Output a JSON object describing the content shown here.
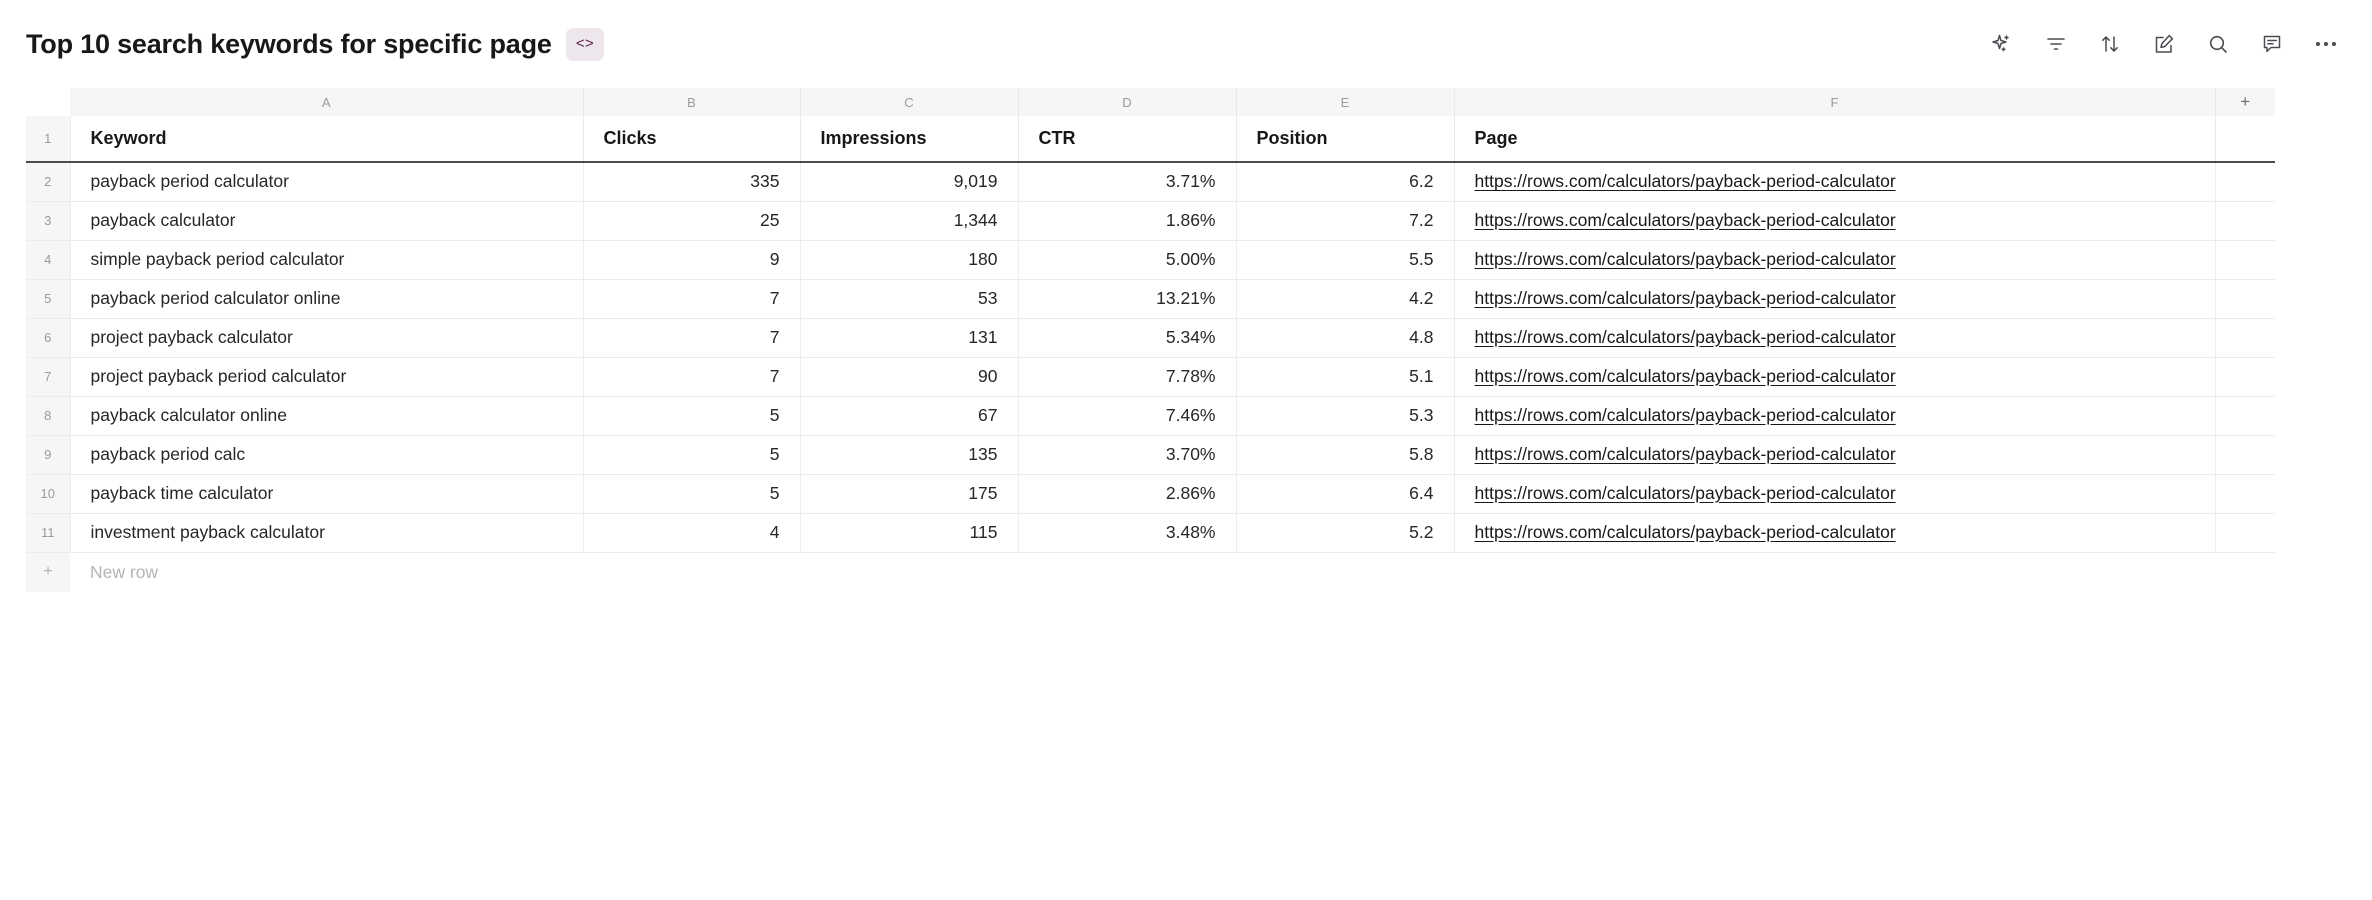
{
  "header": {
    "title": "Top 10 search keywords for specific page",
    "code_badge": "<>",
    "toolbar": [
      {
        "name": "ai-sparkle-icon",
        "label": "AI assistant"
      },
      {
        "name": "filter-icon",
        "label": "Filter"
      },
      {
        "name": "sort-icon",
        "label": "Sort"
      },
      {
        "name": "edit-icon",
        "label": "Edit"
      },
      {
        "name": "search-icon",
        "label": "Search"
      },
      {
        "name": "comment-icon",
        "label": "Comments"
      },
      {
        "name": "more-options-icon",
        "label": "More options"
      }
    ]
  },
  "grid": {
    "column_letters": [
      "A",
      "B",
      "C",
      "D",
      "E",
      "F"
    ],
    "add_column_label": "+",
    "header_row_number": "1",
    "headers": [
      "Keyword",
      "Clicks",
      "Impressions",
      "CTR",
      "Position",
      "Page"
    ],
    "rows": [
      {
        "n": "2",
        "keyword": "payback period calculator",
        "clicks": "335",
        "impressions": "9,019",
        "ctr": "3.71%",
        "position": "6.2",
        "page": "https://rows.com/calculators/payback-period-calculator"
      },
      {
        "n": "3",
        "keyword": "payback calculator",
        "clicks": "25",
        "impressions": "1,344",
        "ctr": "1.86%",
        "position": "7.2",
        "page": "https://rows.com/calculators/payback-period-calculator"
      },
      {
        "n": "4",
        "keyword": "simple payback period calculator",
        "clicks": "9",
        "impressions": "180",
        "ctr": "5.00%",
        "position": "5.5",
        "page": "https://rows.com/calculators/payback-period-calculator"
      },
      {
        "n": "5",
        "keyword": "payback period calculator online",
        "clicks": "7",
        "impressions": "53",
        "ctr": "13.21%",
        "position": "4.2",
        "page": "https://rows.com/calculators/payback-period-calculator"
      },
      {
        "n": "6",
        "keyword": "project payback calculator",
        "clicks": "7",
        "impressions": "131",
        "ctr": "5.34%",
        "position": "4.8",
        "page": "https://rows.com/calculators/payback-period-calculator"
      },
      {
        "n": "7",
        "keyword": "project payback period calculator",
        "clicks": "7",
        "impressions": "90",
        "ctr": "7.78%",
        "position": "5.1",
        "page": "https://rows.com/calculators/payback-period-calculator"
      },
      {
        "n": "8",
        "keyword": "payback calculator online",
        "clicks": "5",
        "impressions": "67",
        "ctr": "7.46%",
        "position": "5.3",
        "page": "https://rows.com/calculators/payback-period-calculator"
      },
      {
        "n": "9",
        "keyword": "payback period calc",
        "clicks": "5",
        "impressions": "135",
        "ctr": "3.70%",
        "position": "5.8",
        "page": "https://rows.com/calculators/payback-period-calculator"
      },
      {
        "n": "10",
        "keyword": "payback time calculator",
        "clicks": "5",
        "impressions": "175",
        "ctr": "2.86%",
        "position": "6.4",
        "page": "https://rows.com/calculators/payback-period-calculator"
      },
      {
        "n": "11",
        "keyword": "investment payback calculator",
        "clicks": "4",
        "impressions": "115",
        "ctr": "3.48%",
        "position": "5.2",
        "page": "https://rows.com/calculators/payback-period-calculator"
      }
    ],
    "new_row": {
      "plus": "+",
      "label": "New row"
    }
  },
  "colors": {
    "badge_bg": "#eee6ed",
    "badge_fg": "#5b1f48",
    "header_strip_bg": "#f6f6f6",
    "grid_line": "#ececed",
    "header_underline": "#4a4a4f",
    "text": "#18181b",
    "muted": "#9a9aa0"
  }
}
